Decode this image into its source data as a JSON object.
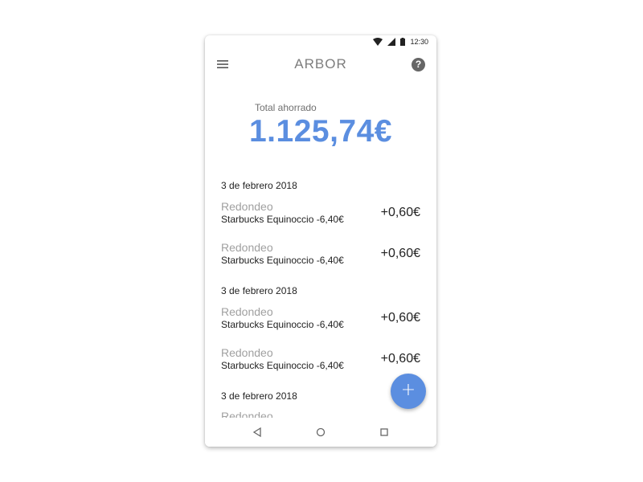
{
  "status_bar": {
    "time": "12:30"
  },
  "app_bar": {
    "title": "ARBOR",
    "help_label": "?"
  },
  "summary": {
    "label": "Total ahorrado",
    "amount": "1.125,74€"
  },
  "colors": {
    "accent": "#5b8ee0",
    "text_dark": "#222222",
    "text_muted": "#a0a0a0"
  },
  "feed": {
    "groups": [
      {
        "date": "3 de febrero 2018",
        "items": [
          {
            "type": "Redondeo",
            "description": "Starbucks Equinoccio -6,40€",
            "amount": "+0,60€"
          },
          {
            "type": "Redondeo",
            "description": "Starbucks Equinoccio -6,40€",
            "amount": "+0,60€"
          }
        ]
      },
      {
        "date": "3 de febrero 2018",
        "items": [
          {
            "type": "Redondeo",
            "description": "Starbucks Equinoccio -6,40€",
            "amount": "+0,60€"
          },
          {
            "type": "Redondeo",
            "description": "Starbucks Equinoccio -6,40€",
            "amount": "+0,60€"
          }
        ]
      },
      {
        "date": "3 de febrero 2018",
        "items": [
          {
            "type": "Redondeo"
          }
        ]
      }
    ]
  },
  "fab": {
    "label": "+"
  },
  "icons": {
    "menu": "hamburger-menu-icon",
    "help": "help-circle-icon",
    "wifi": "wifi-icon",
    "signal": "cell-signal-icon",
    "battery": "battery-icon",
    "back": "back-triangle-icon",
    "home": "home-circle-icon",
    "recents": "recents-square-icon"
  }
}
